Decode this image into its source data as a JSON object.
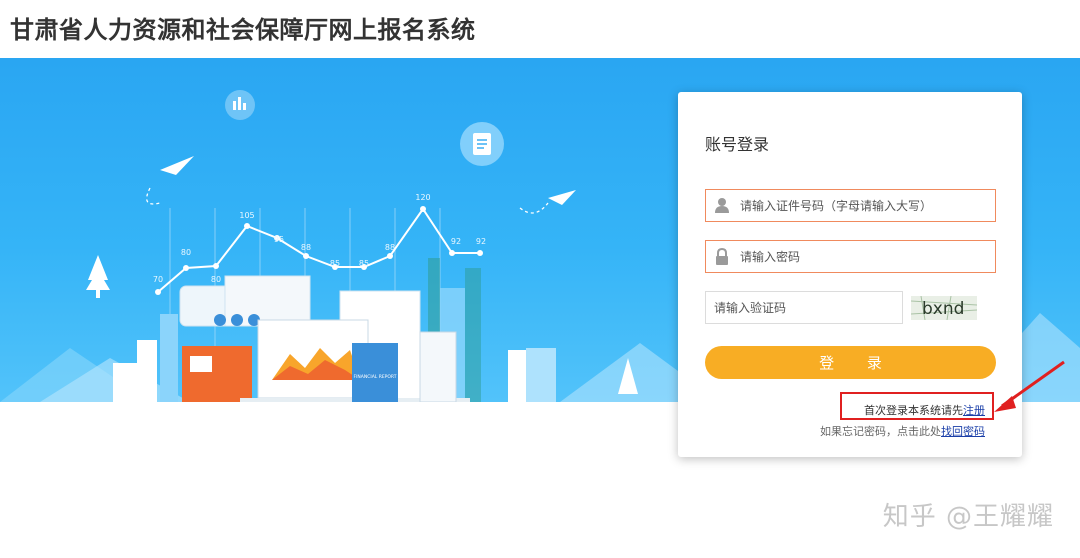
{
  "header": {
    "title": "甘肃省人力资源和社会保障厅网上报名系统"
  },
  "login": {
    "title": "账号登录",
    "id_placeholder": "请输入证件号码（字母请输入大写）",
    "password_placeholder": "请输入密码",
    "captcha_placeholder": "请输入验证码",
    "captcha_text": "bxnd",
    "submit_label": "登 录",
    "register_prefix": "首次登录本系统请先",
    "register_link": "注册",
    "forgot_prefix": "如果忘记密码，点击此处",
    "forgot_link": "找回密码"
  },
  "illustration": {
    "chart_labels": [
      "70",
      "80",
      "80",
      "105",
      "95",
      "88",
      "85",
      "85",
      "88",
      "120",
      "92",
      "92"
    ],
    "report_caption": "FINANCIAL REPORT"
  },
  "watermark": "知乎 @王耀耀",
  "colors": {
    "banner": "#35b4f7",
    "primary_button": "#f8ad24",
    "input_border": "#f08a5d",
    "link": "#1a3ea8",
    "annotation": "#e02020"
  }
}
